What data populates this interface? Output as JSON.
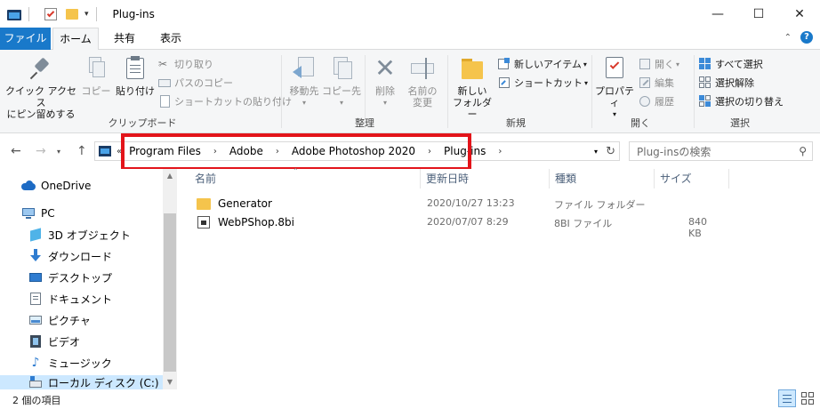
{
  "window": {
    "title": "Plug-ins",
    "controls": [
      "—",
      "☐",
      "✕"
    ]
  },
  "ribbon_tabs": {
    "file": "ファイル",
    "home": "ホーム",
    "share": "共有",
    "view": "表示"
  },
  "ribbon": {
    "clipboard": {
      "pin": "クイック アクセス\nにピン留めする",
      "pin_line1": "クイック アクセス",
      "pin_line2": "にピン留めする",
      "copy": "コピー",
      "paste": "貼り付け",
      "cut": "切り取り",
      "copy_path": "パスのコピー",
      "paste_shortcut": "ショートカットの貼り付け",
      "label": "クリップボード"
    },
    "organize": {
      "move_to": "移動先",
      "copy_to": "コピー先",
      "delete": "削除",
      "rename_line1": "名前の",
      "rename_line2": "変更",
      "label": "整理"
    },
    "new": {
      "new_folder_line1": "新しい",
      "new_folder_line2": "フォルダー",
      "new_item": "新しいアイテム",
      "shortcut": "ショートカット",
      "label": "新規"
    },
    "open": {
      "properties": "プロパティ",
      "open": "開く",
      "edit": "編集",
      "history": "履歴",
      "label": "開く"
    },
    "select": {
      "select_all": "すべて選択",
      "select_none": "選択解除",
      "invert": "選択の切り替え",
      "label": "選択"
    }
  },
  "address": {
    "breadcrumbs": [
      "Program Files",
      "Adobe",
      "Adobe Photoshop 2020",
      "Plug-ins"
    ],
    "search_placeholder": "Plug-insの検索"
  },
  "nav_pane": {
    "items": [
      {
        "label": "OneDrive",
        "icon": "onedrive-icon"
      },
      {
        "label": "PC",
        "icon": "pc-icon"
      },
      {
        "label": "3D オブジェクト",
        "icon": "3d-objects-icon"
      },
      {
        "label": "ダウンロード",
        "icon": "download-icon"
      },
      {
        "label": "デスクトップ",
        "icon": "desktop-icon"
      },
      {
        "label": "ドキュメント",
        "icon": "document-icon"
      },
      {
        "label": "ピクチャ",
        "icon": "pictures-icon"
      },
      {
        "label": "ビデオ",
        "icon": "video-icon"
      },
      {
        "label": "ミュージック",
        "icon": "music-icon"
      },
      {
        "label": "ローカル ディスク (C:)",
        "icon": "drive-icon"
      }
    ]
  },
  "columns": {
    "name": "名前",
    "modified": "更新日時",
    "type": "種類",
    "size": "サイズ"
  },
  "files": [
    {
      "name": "Generator",
      "modified": "2020/10/27 13:23",
      "type": "ファイル フォルダー",
      "size": ""
    },
    {
      "name": "WebPShop.8bi",
      "modified": "2020/07/07 8:29",
      "type": "8BI ファイル",
      "size": "840 KB"
    }
  ],
  "status": {
    "count": "2 個の項目"
  },
  "colors": {
    "accent": "#1979ca",
    "highlight": "#e3141a",
    "folder": "#f5c44c"
  }
}
